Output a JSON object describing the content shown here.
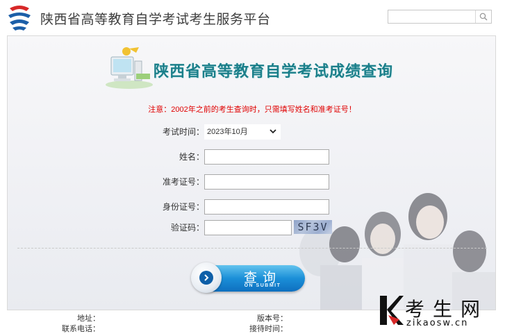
{
  "header": {
    "site_title": "陕西省高等教育自学考试考生服务平台",
    "search": {
      "value": "",
      "icon": "search-icon"
    }
  },
  "banner": {
    "title": "陕西省高等教育自学考试成绩查询",
    "icon": "computer-icon"
  },
  "notice": "注意：2002年之前的考生查询时，只需填写姓名和准考证号！",
  "form": {
    "exam_time": {
      "label": "考试时间：",
      "selected": "2023年10月"
    },
    "name": {
      "label": "姓名：",
      "value": ""
    },
    "ticket": {
      "label": "准考证号：",
      "value": ""
    },
    "id_card": {
      "label": "身份证号：",
      "value": ""
    },
    "captcha": {
      "label": "验证码：",
      "value": "",
      "image_text": "SF3V"
    },
    "submit": {
      "label": "查询",
      "sub_label": "ON SUBMIT"
    }
  },
  "footer": {
    "address_label": "地址：",
    "phone_label": "联系电话：",
    "version_label": "版本号：",
    "reception_label": "接待时间："
  },
  "watermark": {
    "letter": "K",
    "text": "考生网",
    "url": "zikaosw.cn"
  },
  "colors": {
    "title_teal": "#1b7f8a",
    "notice_red": "#e00000",
    "button_blue": "#1b8fd8",
    "logo_red": "#d72828",
    "logo_blue": "#1c5fa8"
  }
}
